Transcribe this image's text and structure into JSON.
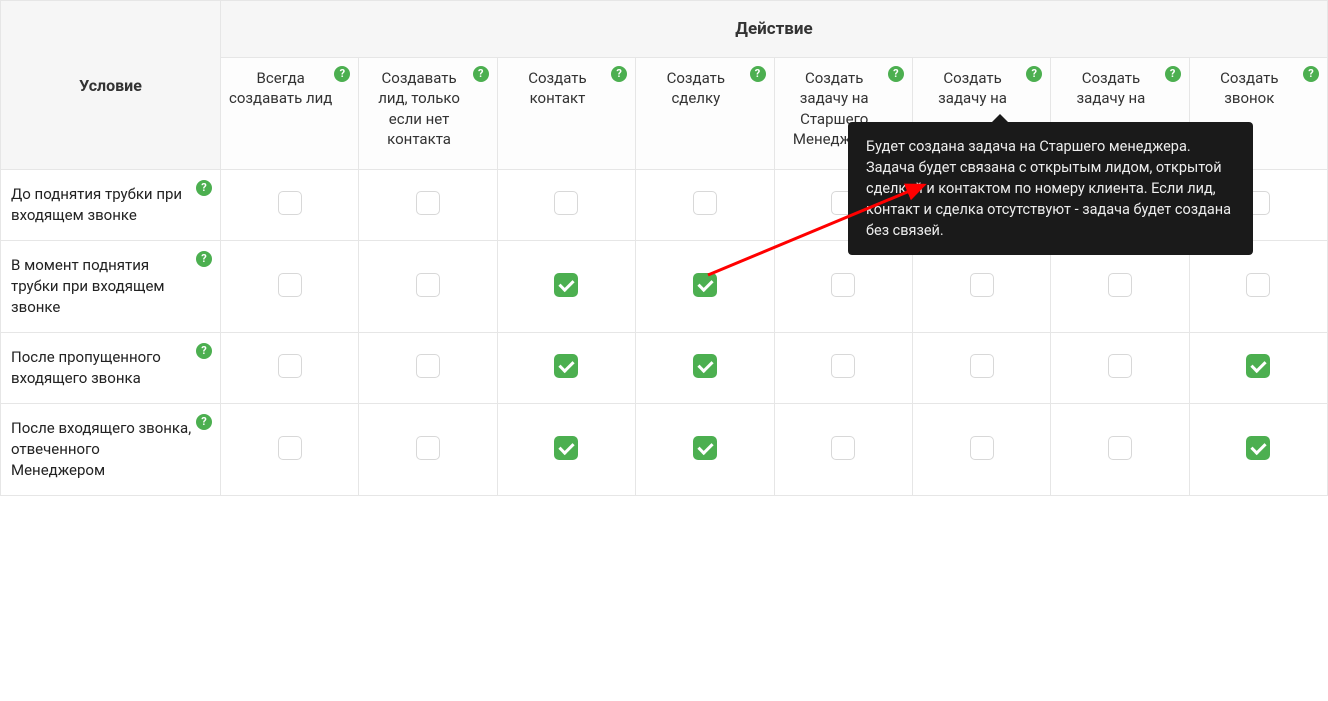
{
  "headers": {
    "condition": "Условие",
    "action": "Действие"
  },
  "columns": [
    "Всегда создавать лид",
    "Создавать лид, только если нет контакта",
    "Создать контакт",
    "Создать сделку",
    "Создать задачу на Старшего Менеджера",
    "Создать задачу на",
    "Создать задачу на",
    "Создать звонок"
  ],
  "rows": [
    {
      "label": "До поднятия трубки при входящем звонке",
      "checks": [
        false,
        false,
        false,
        false,
        false,
        false,
        false,
        false
      ]
    },
    {
      "label": "В момент поднятия трубки при входящем звонке",
      "checks": [
        false,
        false,
        true,
        true,
        false,
        false,
        false,
        false
      ]
    },
    {
      "label": "После пропущенного входящего звонка",
      "checks": [
        false,
        false,
        true,
        true,
        false,
        false,
        false,
        true
      ]
    },
    {
      "label": "После входящего звонка, отвеченного Менеджером",
      "checks": [
        false,
        false,
        true,
        true,
        false,
        false,
        false,
        true
      ]
    }
  ],
  "tooltip": "Будет создана задача на Старшего менеджера. Задача будет связана с открытым лидом, открытой сделкой и контактом по номеру клиента. Если лид, контакт и сделка отсутствуют - задача будет создана без связей."
}
